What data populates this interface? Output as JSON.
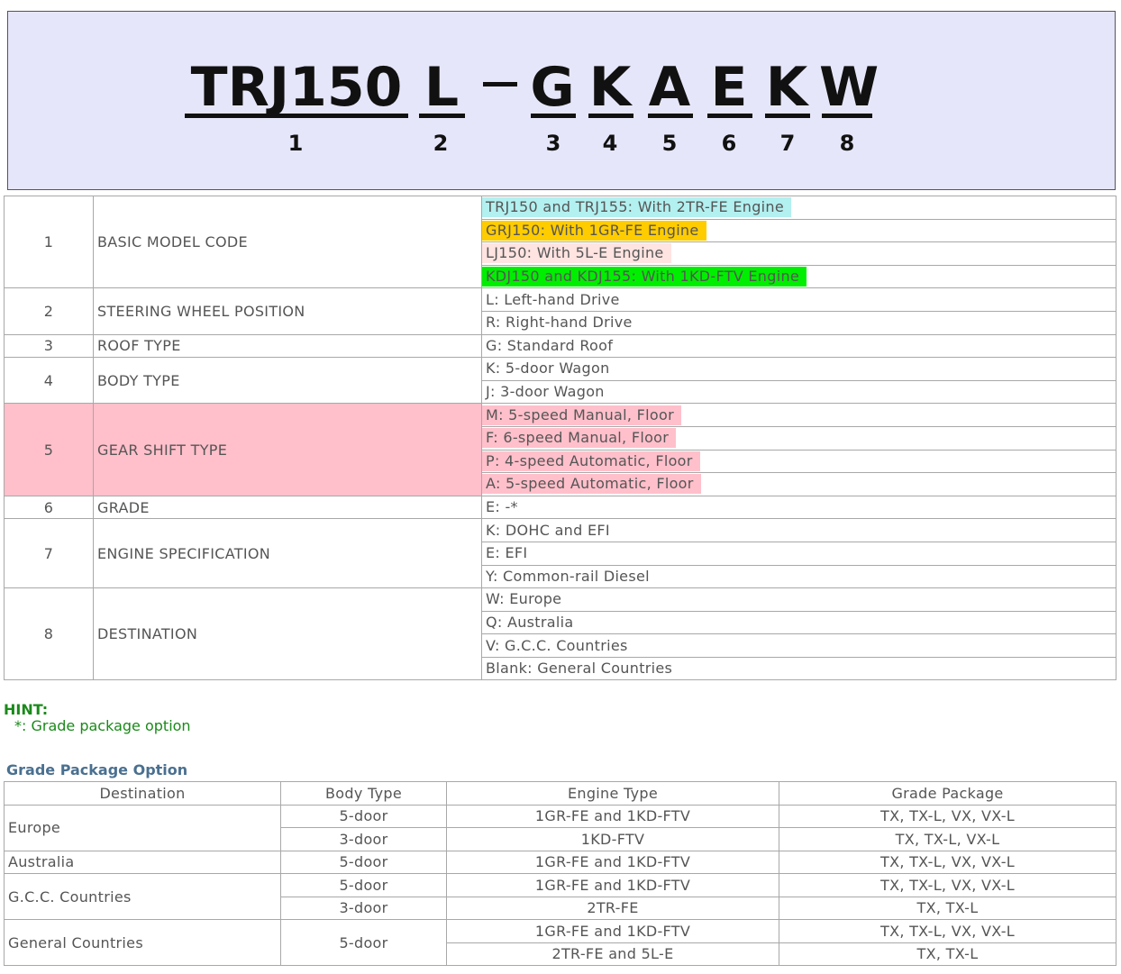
{
  "model_code": {
    "parts": [
      "TRJ150",
      "L",
      "G",
      "K",
      "A",
      "E",
      "K",
      "W"
    ],
    "separator": "-",
    "positions": [
      "1",
      "2",
      "3",
      "4",
      "5",
      "6",
      "7",
      "8"
    ]
  },
  "codes": [
    {
      "num": "1",
      "name": "BASIC MODEL CODE",
      "options": [
        {
          "text": "TRJ150 and TRJ155: With 2TR-FE Engine",
          "color": "#b3f0f0"
        },
        {
          "text": "GRJ150: With 1GR-FE Engine",
          "color": "#ffcc00"
        },
        {
          "text": "LJ150: With 5L-E Engine",
          "color": "#ffe4e1"
        },
        {
          "text": "KDJ150 and KDJ155: With 1KD-FTV Engine",
          "color": "#00ee00"
        }
      ]
    },
    {
      "num": "2",
      "name": "STEERING WHEEL POSITION",
      "options": [
        {
          "text": "L: Left-hand Drive"
        },
        {
          "text": "R: Right-hand Drive"
        }
      ]
    },
    {
      "num": "3",
      "name": "ROOF TYPE",
      "options": [
        {
          "text": "G: Standard Roof"
        }
      ]
    },
    {
      "num": "4",
      "name": "BODY TYPE",
      "options": [
        {
          "text": "K: 5-door Wagon"
        },
        {
          "text": "J: 3-door Wagon"
        }
      ]
    },
    {
      "num": "5",
      "name": "GEAR SHIFT TYPE",
      "row_color": "#ffc0cb",
      "options": [
        {
          "text": "M: 5-speed Manual, Floor",
          "color": "#ffc0cb"
        },
        {
          "text": "F: 6-speed Manual, Floor",
          "color": "#ffc0cb"
        },
        {
          "text": "P: 4-speed Automatic, Floor",
          "color": "#ffc0cb"
        },
        {
          "text": "A: 5-speed Automatic, Floor",
          "color": "#ffc0cb"
        }
      ]
    },
    {
      "num": "6",
      "name": "GRADE",
      "options": [
        {
          "text": "E: -*"
        }
      ]
    },
    {
      "num": "7",
      "name": "ENGINE SPECIFICATION",
      "options": [
        {
          "text": "K: DOHC and EFI"
        },
        {
          "text": "E: EFI"
        },
        {
          "text": "Y: Common-rail Diesel"
        }
      ]
    },
    {
      "num": "8",
      "name": "DESTINATION",
      "options": [
        {
          "text": "W: Europe"
        },
        {
          "text": "Q: Australia"
        },
        {
          "text": "V: G.C.C. Countries"
        },
        {
          "text": "Blank: General Countries"
        }
      ]
    }
  ],
  "hint": {
    "title": "HINT:",
    "text": "*: Grade package option"
  },
  "grade_package": {
    "title": "Grade Package Option",
    "headers": [
      "Destination",
      "Body Type",
      "Engine Type",
      "Grade Package"
    ],
    "groups": [
      {
        "destination": "Europe",
        "bodies": [
          {
            "body": "5-door",
            "rows": [
              {
                "engine": "1GR-FE and 1KD-FTV",
                "grade": "TX, TX-L, VX, VX-L"
              }
            ]
          },
          {
            "body": "3-door",
            "rows": [
              {
                "engine": "1KD-FTV",
                "grade": "TX, TX-L, VX-L"
              }
            ]
          }
        ]
      },
      {
        "destination": "Australia",
        "bodies": [
          {
            "body": "5-door",
            "rows": [
              {
                "engine": "1GR-FE and 1KD-FTV",
                "grade": "TX, TX-L, VX, VX-L"
              }
            ]
          }
        ]
      },
      {
        "destination": "G.C.C. Countries",
        "bodies": [
          {
            "body": "5-door",
            "rows": [
              {
                "engine": "1GR-FE and 1KD-FTV",
                "grade": "TX, TX-L, VX, VX-L"
              }
            ]
          },
          {
            "body": "3-door",
            "rows": [
              {
                "engine": "2TR-FE",
                "grade": "TX, TX-L"
              }
            ]
          }
        ]
      },
      {
        "destination": "General Countries",
        "bodies": [
          {
            "body": "5-door",
            "rows": [
              {
                "engine": "1GR-FE and 1KD-FTV",
                "grade": "TX, TX-L, VX, VX-L"
              },
              {
                "engine": "2TR-FE and 5L-E",
                "grade": "TX, TX-L"
              }
            ]
          }
        ]
      }
    ]
  }
}
